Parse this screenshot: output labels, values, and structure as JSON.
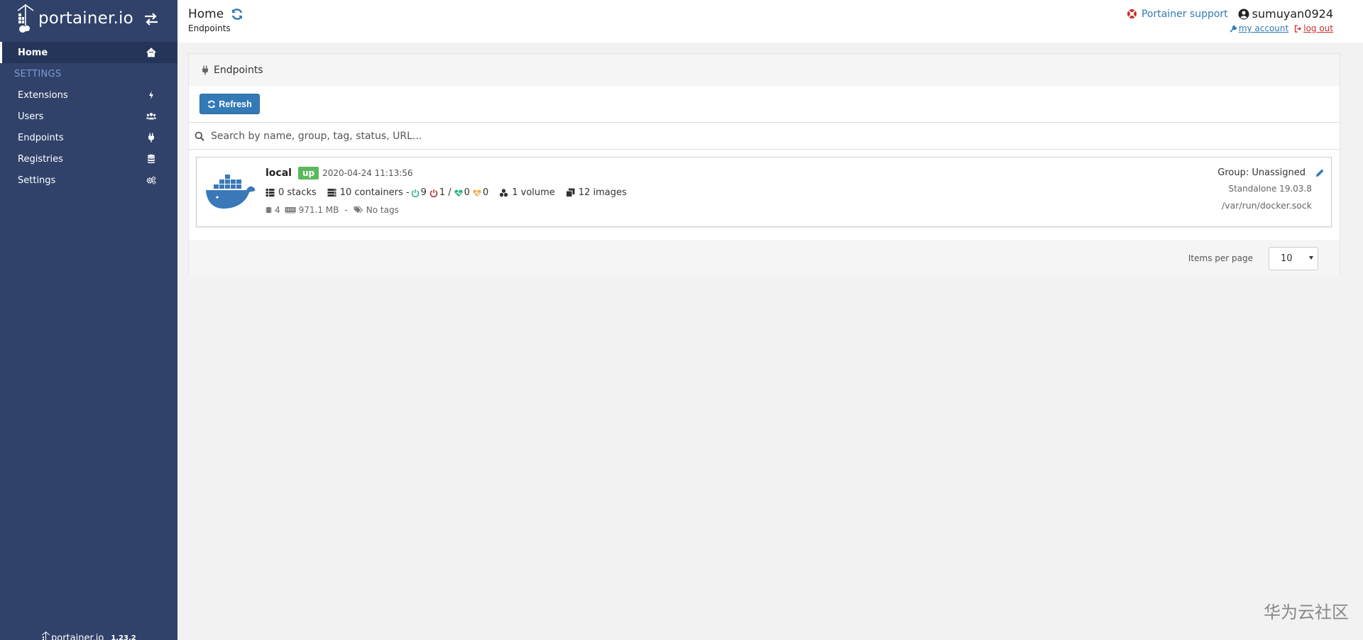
{
  "app": {
    "brand_name": "portainer.io",
    "version": "1.23.2"
  },
  "sidebar": {
    "home_label": "Home",
    "settings_heading": "SETTINGS",
    "items": [
      {
        "label": "Extensions",
        "icon": "bolt-icon"
      },
      {
        "label": "Users",
        "icon": "users-icon"
      },
      {
        "label": "Endpoints",
        "icon": "plug-icon"
      },
      {
        "label": "Registries",
        "icon": "database-icon"
      },
      {
        "label": "Settings",
        "icon": "cogs-icon"
      }
    ]
  },
  "header": {
    "title": "Home",
    "breadcrumb": "Endpoints",
    "support_label": "Portainer support",
    "username": "sumuyan0924",
    "my_account_label": "my account",
    "logout_label": "log out"
  },
  "panel": {
    "heading": "Endpoints",
    "refresh_label": "Refresh",
    "search_placeholder": "Search by name, group, tag, status, URL..."
  },
  "endpoint": {
    "name": "local",
    "status": "up",
    "timestamp": "2020-04-24 11:13:56",
    "stacks": "0 stacks",
    "containers": "10 containers -",
    "running": "9",
    "stopped": "1 /",
    "healthy": "0",
    "unhealthy": "0",
    "volumes": "1 volume",
    "images": "12 images",
    "cpu": "4",
    "memory": "971.1 MB",
    "separator": "-",
    "tags": "No tags",
    "group": "Group: Unassigned",
    "engine": "Standalone 19.03.8",
    "url": "/var/run/docker.sock"
  },
  "pagination": {
    "items_per_page_label": "Items per page",
    "items_per_page_value": "10"
  },
  "watermark": "华为云社区",
  "colors": {
    "sidebar_bg": "#30426a",
    "accent": "#337ab7",
    "status_up": "#5cb85c",
    "danger": "#c9302c"
  }
}
